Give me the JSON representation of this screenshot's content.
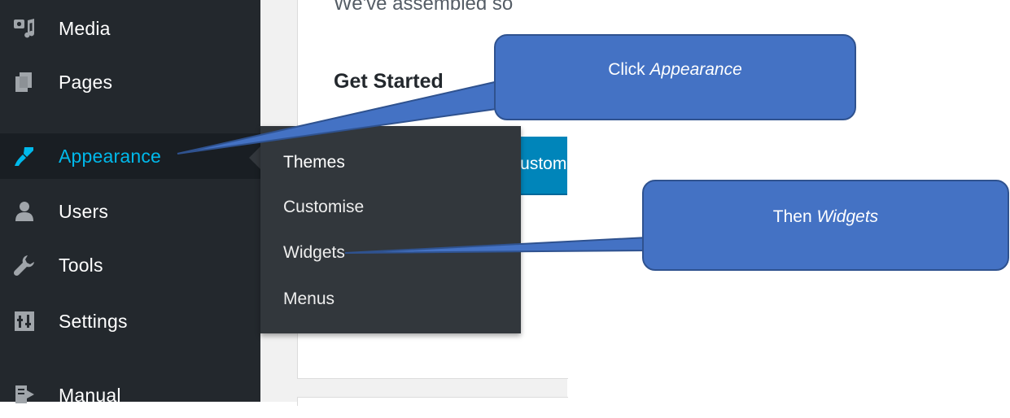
{
  "sidebar": {
    "items": [
      {
        "label": "Media",
        "icon": "media-icon"
      },
      {
        "label": "Pages",
        "icon": "pages-icon"
      },
      {
        "label": "Appearance",
        "icon": "paintbrush-icon",
        "active": true
      },
      {
        "label": "Users",
        "icon": "users-icon"
      },
      {
        "label": "Tools",
        "icon": "wrench-icon"
      },
      {
        "label": "Settings",
        "icon": "settings-icon"
      },
      {
        "label": "Manual",
        "icon": "manual-icon"
      }
    ]
  },
  "submenu": {
    "items": [
      {
        "label": "Themes"
      },
      {
        "label": "Customise"
      },
      {
        "label": "Widgets"
      },
      {
        "label": "Menus"
      }
    ]
  },
  "content": {
    "intro_text": "We've assembled so",
    "heading": "Get Started",
    "button_label": "Customise Your Site"
  },
  "callouts": {
    "first": {
      "prefix": "Click ",
      "emphasis": "Appearance"
    },
    "second": {
      "prefix": "Then ",
      "emphasis": "Widgets"
    }
  },
  "colors": {
    "sidebar_bg": "#23282d",
    "submenu_bg": "#32373c",
    "active_text": "#00b9eb",
    "button_bg": "#0085ba",
    "callout_fill": "#4472c4"
  }
}
